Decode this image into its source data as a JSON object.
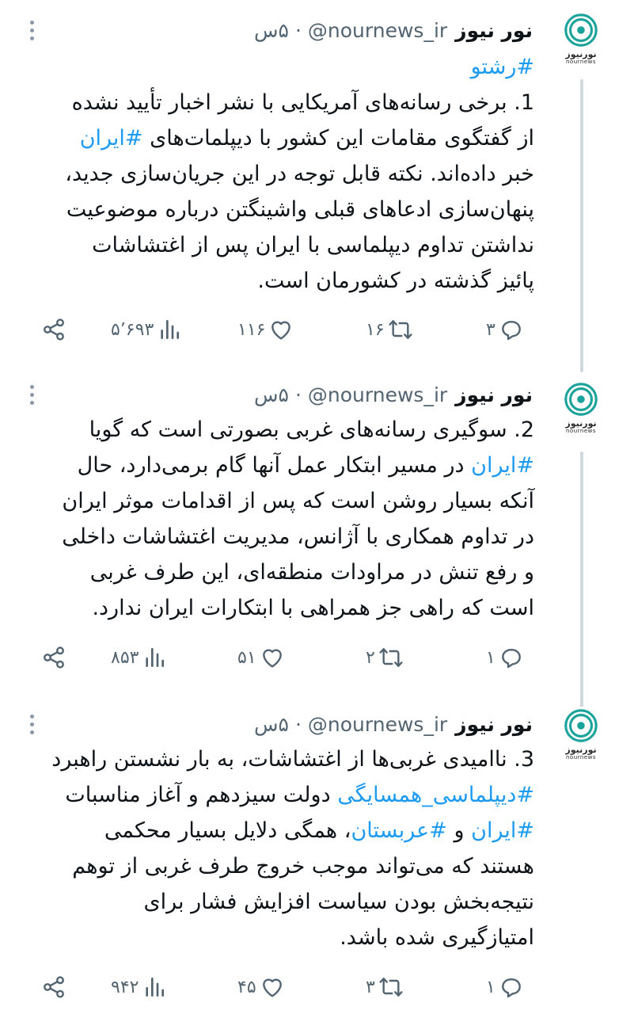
{
  "account": {
    "name": "نور نیوز",
    "handle": "@nournews_ir",
    "separator": "·",
    "time": "۵س",
    "avatar_fa": "نورنیوز",
    "avatar_en": "nournews"
  },
  "colors": {
    "link": "#1d9bf0",
    "meta": "#536471",
    "brand": "#1aa39a"
  },
  "tweets": [
    {
      "lines": [
        [
          {
            "t": "",
            "h": "#رشتو"
          }
        ],
        [
          {
            "t": "1. برخی رسانه‌های آمریکایی با نشر اخبار تأیید نشده"
          }
        ],
        [
          {
            "t": "از گفتگوی مقامات این کشور با دیپلمات‌های "
          },
          {
            "h": "#ایران"
          }
        ],
        [
          {
            "t": "خبر داده‌اند. نکته قابل توجه در این جریان‌سازی جدید،"
          }
        ],
        [
          {
            "t": "پنهان‌سازی ادعاهای قبلی واشینگتن درباره موضوعیت"
          }
        ],
        [
          {
            "t": "نداشتن تداوم دیپلماسی با ایران پس از اغتشاشات"
          }
        ],
        [
          {
            "t": "پائیز گذشته در کشورمان است."
          }
        ]
      ],
      "stats": {
        "replies": "۳",
        "retweets": "۱۶",
        "likes": "۱۱۶",
        "views": "۵٬۶۹۳"
      }
    },
    {
      "lines": [
        [
          {
            "t": "2. سوگیری رسانه‌های غربی بصورتی است که گویا"
          }
        ],
        [
          {
            "h": "#ایران"
          },
          {
            "t": " در مسیر ابتکار عمل آنها گام برمی‌دارد، حال"
          }
        ],
        [
          {
            "t": "آنکه بسیار روشن است که پس از اقدامات موثر ایران"
          }
        ],
        [
          {
            "t": "در تداوم همکاری با آژانس، مدیریت اغتشاشات داخلی"
          }
        ],
        [
          {
            "t": "و رفع تنش در مراودات منطقه‌ای، این طرف غربی"
          }
        ],
        [
          {
            "t": "است که راهی جز همراهی با ابتکارات ایران ندارد."
          }
        ]
      ],
      "stats": {
        "replies": "۱",
        "retweets": "۲",
        "likes": "۵۱",
        "views": "۸۵۳"
      }
    },
    {
      "lines": [
        [
          {
            "t": "3. ناامیدی غربی‌ها از اغتشاشات، به بار نشستن راهبرد"
          }
        ],
        [
          {
            "h": "#دیپلماسی_همسایگی"
          },
          {
            "t": " دولت سیزدهم و آغاز مناسبات"
          }
        ],
        [
          {
            "h": "#ایران"
          },
          {
            "t": " و "
          },
          {
            "h": "#عربستان"
          },
          {
            "t": "، همگی دلایل بسیار محکمی"
          }
        ],
        [
          {
            "t": "هستند که می‌تواند موجب خروج طرف غربی از توهم"
          }
        ],
        [
          {
            "t": "نتیجه‌بخش بودن سیاست افزایش فشار برای"
          }
        ],
        [
          {
            "t": "امتیازگیری شده باشد."
          }
        ]
      ],
      "stats": {
        "replies": "۱",
        "retweets": "۳",
        "likes": "۴۵",
        "views": "۹۴۲"
      }
    }
  ]
}
